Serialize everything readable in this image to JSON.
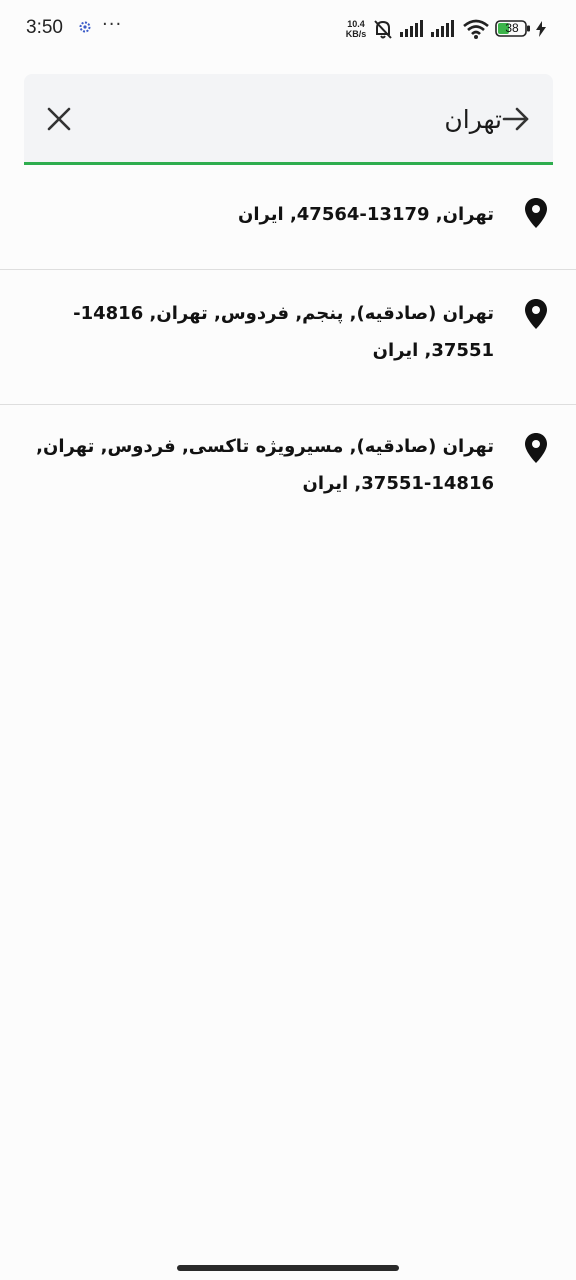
{
  "status_bar": {
    "time": "3:50",
    "more": "···",
    "net_speed_value": "10.4",
    "net_speed_unit": "KB/s",
    "battery_level": "38",
    "icons": [
      "settings-gear-icon",
      "more-dots-icon",
      "mute-notifications-icon",
      "signal-icon",
      "signal-icon",
      "wifi-icon",
      "battery-icon",
      "charging-bolt-icon"
    ]
  },
  "search": {
    "value": "تهران",
    "accent_color": "#2ead4e",
    "clear_icon": "close-icon",
    "submit_icon": "arrow-right-icon"
  },
  "results": [
    {
      "text": "تهران, 13179-47564, ایران",
      "icon": "location-pin-icon"
    },
    {
      "text": "تهران (صادقیه), پنجم, فردوس, تهران, 14816-37551, ایران",
      "icon": "location-pin-icon"
    },
    {
      "text": "تهران (صادقیه), مسیرویژه تاکسی, فردوس, تهران, 14816-37551, ایران",
      "icon": "location-pin-icon"
    }
  ]
}
